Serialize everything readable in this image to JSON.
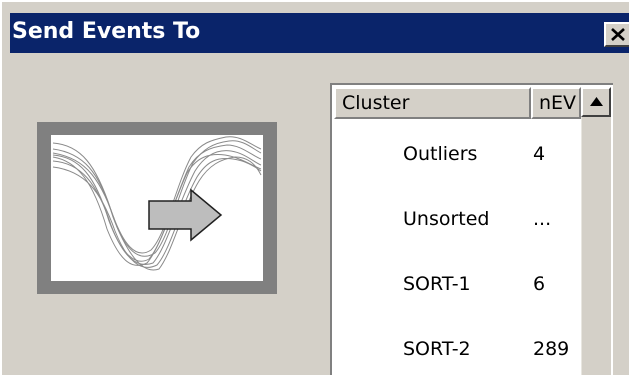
{
  "window": {
    "title": "Send Events To"
  },
  "list": {
    "columns": [
      "Cluster",
      "nEV"
    ],
    "rows": [
      {
        "cluster": "Outliers",
        "nev": "4"
      },
      {
        "cluster": "Unsorted",
        "nev": "..."
      },
      {
        "cluster": "SORT-1",
        "nev": "6"
      },
      {
        "cluster": "SORT-2",
        "nev": "289"
      }
    ]
  },
  "icons": {
    "close": "close-icon",
    "scroll_up": "scroll-up-arrow-icon",
    "preview": "waveform-send-icon"
  },
  "colors": {
    "titlebar": "#0a246a",
    "dialog_bg": "#d4d0c8",
    "preview_frame": "#808080"
  }
}
